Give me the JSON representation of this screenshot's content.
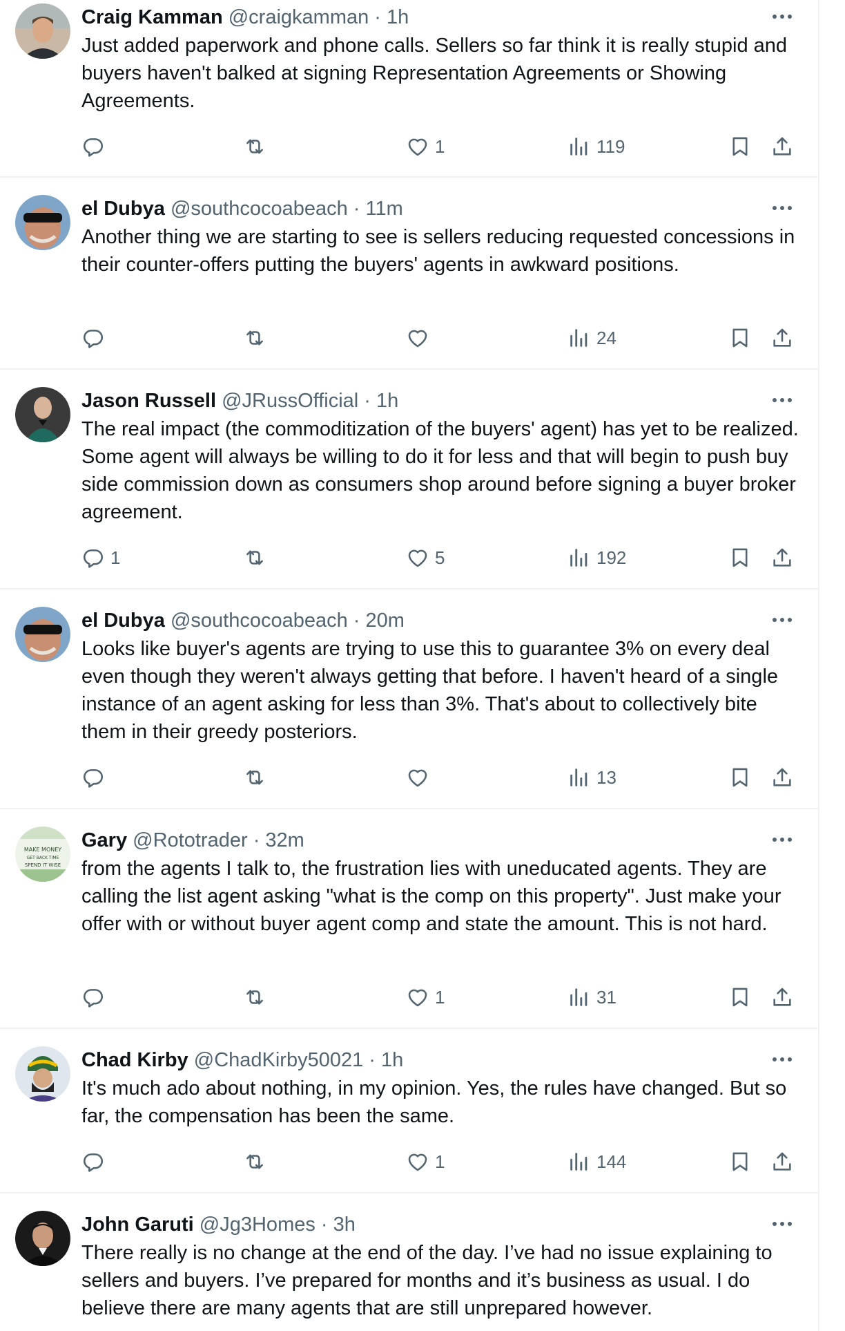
{
  "colors": {
    "text_primary": "#0f1419",
    "text_secondary": "#536471",
    "divider": "#eff3f4"
  },
  "tweets": [
    {
      "name": "Craig Kamman",
      "handle": "@craigkamman",
      "time": "· 1h",
      "text": "Just added paperwork and phone calls.  Sellers so far think it is really stupid and buyers haven't balked at signing Representation Agreements or Showing Agreements.",
      "replies": "",
      "retweets": "",
      "likes": "1",
      "views": "119"
    },
    {
      "name": "el Dubya",
      "handle": "@southcocoabeach",
      "time": "· 11m",
      "text": "Another thing we are starting to see is sellers reducing requested concessions in their counter-offers putting the buyers' agents in awkward positions.",
      "replies": "",
      "retweets": "",
      "likes": "",
      "views": "24"
    },
    {
      "name": "Jason Russell",
      "handle": "@JRussOfficial",
      "time": "· 1h",
      "text": "The real impact (the commoditization of the buyers' agent) has yet to be realized. Some agent will always be willing to do it for less and that will begin to push buy side commission down as consumers shop around before signing a buyer broker agreement.",
      "replies": "1",
      "retweets": "",
      "likes": "5",
      "views": "192"
    },
    {
      "name": "el Dubya",
      "handle": "@southcocoabeach",
      "time": "· 20m",
      "text": "Looks like buyer's agents are trying to use this to guarantee 3% on every deal even though they weren't always getting that before. I haven't heard of a single instance of an agent asking for less than 3%. That's about to collectively bite them in their greedy posteriors.",
      "replies": "",
      "retweets": "",
      "likes": "",
      "views": "13"
    },
    {
      "name": "Gary",
      "handle": "@Rototrader",
      "time": "· 32m",
      "text": "from the agents I talk to, the frustration lies with uneducated agents. They are calling the list agent asking \"what is the comp on this property\".  Just make your offer with or without buyer agent comp and state the amount. This is not hard.",
      "replies": "",
      "retweets": "",
      "likes": "1",
      "views": "31",
      "avatar_text": [
        "MAKE MONEY",
        "GET BACK TIME",
        "SPEND IT WISE"
      ]
    },
    {
      "name": "Chad Kirby",
      "handle": "@ChadKirby50021",
      "time": "· 1h",
      "text": "It's much ado about nothing, in my opinion. Yes, the rules have changed. But so far, the compensation has been the same.",
      "replies": "",
      "retweets": "",
      "likes": "1",
      "views": "144"
    },
    {
      "name": "John Garuti",
      "handle": "@Jg3Homes",
      "time": "· 3h",
      "text": "There really is no change at the end of the day. I’ve had no issue explaining to sellers and buyers. I’ve prepared for months and it’s business as usual. I do believe there are many agents that are still unprepared however.",
      "replies": "",
      "retweets": "",
      "likes": "",
      "views": ""
    }
  ]
}
